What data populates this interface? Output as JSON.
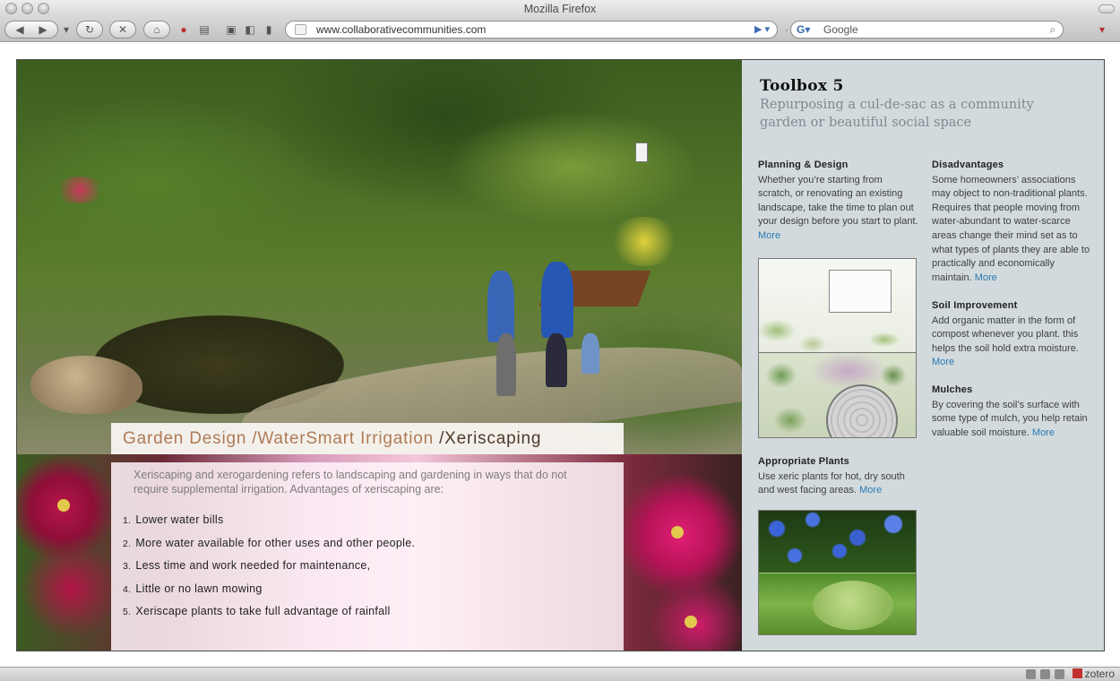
{
  "window": {
    "title": "Mozilla Firefox"
  },
  "browser": {
    "url": "www.collaborativecommunities.com",
    "search_placeholder": "Google",
    "statusbar_addon": "zotero"
  },
  "article": {
    "heading_prefix": "Garden Design /WaterSmart Irrigation ",
    "heading_current": "/Xeriscaping",
    "intro": "Xeriscaping and xerogardening refers to landscaping and gardening in ways that do not require supplemental irrigation. Advantages of xeriscaping are:",
    "list": [
      {
        "num": "1.",
        "text": "Lower water bills"
      },
      {
        "num": "2.",
        "text": "More water available for other uses and other people."
      },
      {
        "num": "3.",
        "text": "Less time and work needed for maintenance,"
      },
      {
        "num": "4.",
        "text": "Little or no lawn mowing"
      },
      {
        "num": "5.",
        "text": "Xeriscape plants to take full advantage of rainfall"
      }
    ]
  },
  "toolbox": {
    "title": "Toolbox 5",
    "subtitle": "Repurposing a cul-de-sac as a community garden or beautiful social space",
    "planning": {
      "heading": "Planning & Design",
      "text": "Whether you’re starting from scratch, or renovating an existing landscape, take the time to plan out your design before you start to plant.",
      "more": "More"
    },
    "plants": {
      "heading": "Appropriate Plants",
      "text": "Use xeric plants for hot, dry south and west facing areas.",
      "more": "More"
    },
    "disadvantages": {
      "heading": "Disadvantages",
      "text": "Some homeowners’ associations may object to non-traditional plants. Requires that people moving from water-abundant to water-scarce areas change their mind set as to what types of plants they are able to practically and economically maintain.",
      "more": "More"
    },
    "soil": {
      "heading": "Soil Improvement",
      "text": "Add organic matter in the form of compost whenever you plant. this helps the soil hold extra moisture.",
      "more": "More"
    },
    "mulches": {
      "heading": "Mulches",
      "text": "By covering the soil’s surface with some type of mulch, you help retain valuable soil moisture.",
      "more": "More"
    }
  },
  "colors": {
    "sidebar_bg": "#d2dadd",
    "link": "#2c79b4",
    "heading_accent": "#b07a55"
  }
}
